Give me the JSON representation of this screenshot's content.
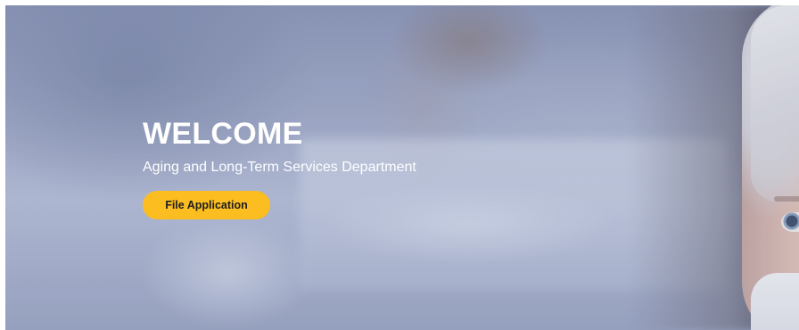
{
  "hero": {
    "title": "WELCOME",
    "subtitle": "Aging and Long-Term Services Department",
    "cta_label": "File Application"
  },
  "colors": {
    "cta_background": "#fbbd20",
    "cta_text": "#1d1d1d",
    "hero_text": "#ffffff",
    "backdrop_tint": "#a4adc9"
  }
}
